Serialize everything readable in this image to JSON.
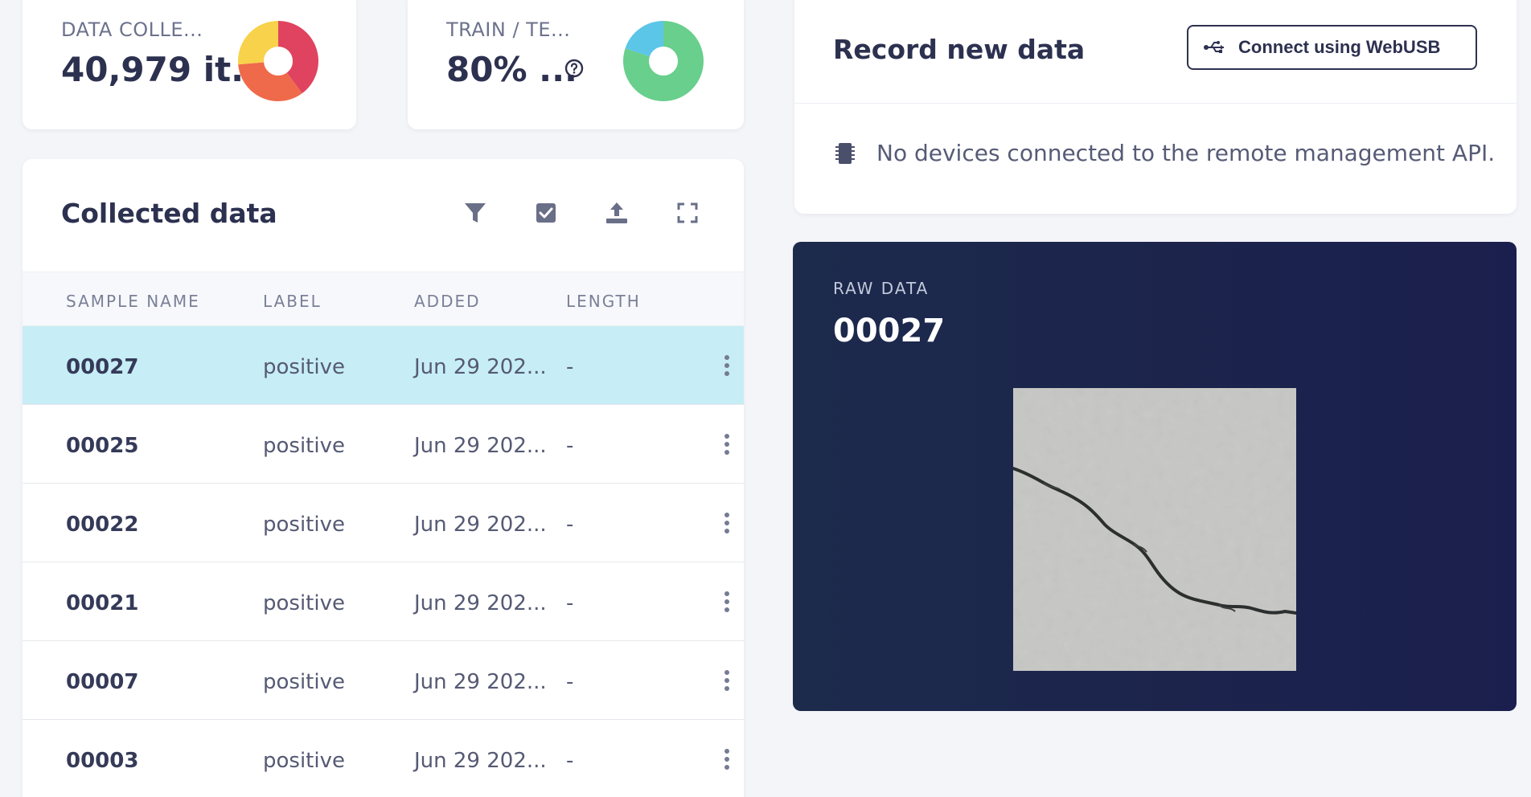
{
  "stats": [
    {
      "label": "DATA COLLE...",
      "value": "40,979 it...",
      "chart_colors": [
        "#e0435f",
        "#ef6a4a",
        "#f7d24a"
      ]
    },
    {
      "label": "TRAIN / TE...",
      "value": "80% ...",
      "chart_colors": [
        "#68cf8c",
        "#5bc6e8"
      ],
      "help_icon": "help-circle-icon"
    }
  ],
  "collected": {
    "title": "Collected data",
    "toolbar_icons": [
      "filter-icon",
      "checkbox-icon",
      "upload-icon",
      "fullscreen-icon"
    ],
    "columns": [
      "SAMPLE NAME",
      "LABEL",
      "ADDED",
      "LENGTH"
    ],
    "rows": [
      {
        "name": "00027",
        "label": "positive",
        "added": "Jun 29 202...",
        "length": "-",
        "selected": true
      },
      {
        "name": "00025",
        "label": "positive",
        "added": "Jun 29 202...",
        "length": "-"
      },
      {
        "name": "00022",
        "label": "positive",
        "added": "Jun 29 202...",
        "length": "-"
      },
      {
        "name": "00021",
        "label": "positive",
        "added": "Jun 29 202...",
        "length": "-"
      },
      {
        "name": "00007",
        "label": "positive",
        "added": "Jun 29 202...",
        "length": "-"
      },
      {
        "name": "00003",
        "label": "positive",
        "added": "Jun 29 202...",
        "length": "-"
      }
    ]
  },
  "record": {
    "title": "Record new data",
    "connect_label": "Connect using WebUSB",
    "no_devices": "No devices connected to the remote management API."
  },
  "raw": {
    "label": "RAW DATA",
    "sample": "00027"
  },
  "colors": {
    "accent_dark": "#2d3150",
    "selected_row": "#c7edf6",
    "raw_panel": "#1c2a4c"
  }
}
